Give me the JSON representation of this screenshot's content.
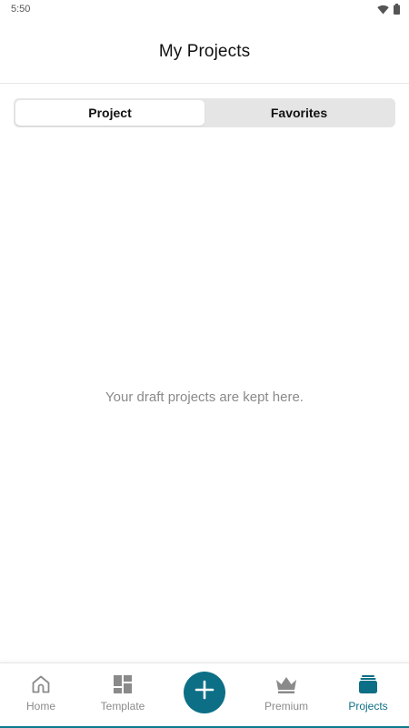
{
  "status_bar": {
    "time": "5:50",
    "icons": [
      "wifi-icon",
      "battery-icon"
    ]
  },
  "header": {
    "title": "My Projects"
  },
  "tabs": [
    {
      "label": "Project",
      "active": true
    },
    {
      "label": "Favorites",
      "active": false
    }
  ],
  "empty_state": {
    "message": "Your draft projects are kept here."
  },
  "bottom_nav": {
    "items": [
      {
        "label": "Home",
        "icon": "home-icon",
        "active": false
      },
      {
        "label": "Template",
        "icon": "template-grid-icon",
        "active": false
      },
      {
        "label": "",
        "icon": "plus-icon",
        "active": false
      },
      {
        "label": "Premium",
        "icon": "crown-icon",
        "active": false
      },
      {
        "label": "Projects",
        "icon": "projects-stack-icon",
        "active": true
      }
    ]
  },
  "colors": {
    "accent": "#0d6f86",
    "inactive": "#8a8a8a",
    "segment_bg": "#e5e5e5"
  }
}
